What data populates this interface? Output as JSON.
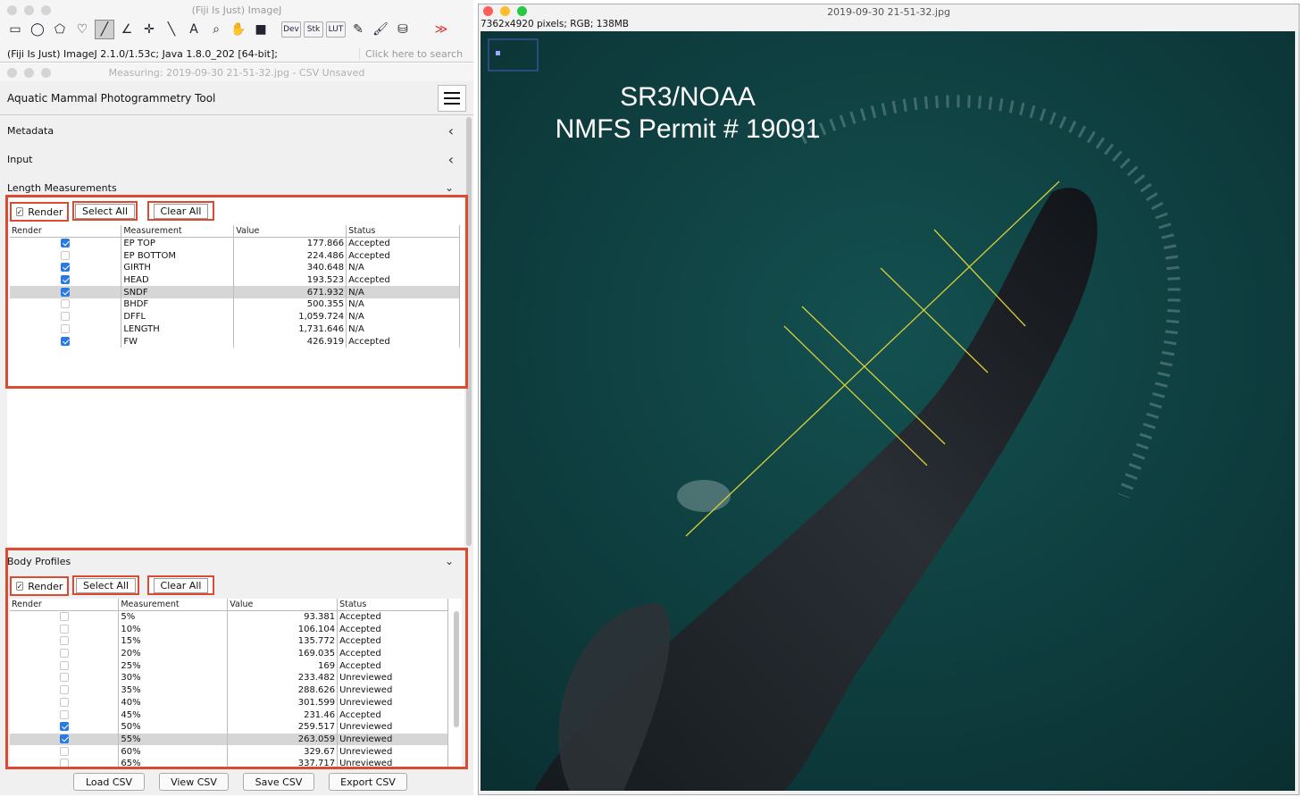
{
  "imagej": {
    "title": "(Fiji Is Just) ImageJ",
    "status": "(Fiji Is Just) ImageJ 2.1.0/1.53c; Java 1.8.0_202 [64-bit];",
    "search_placeholder": "Click here to search",
    "tools_small": [
      "Dev",
      "Stk",
      "LUT"
    ]
  },
  "plugin": {
    "title": "Measuring: 2019-09-30 21-51-32.jpg  - CSV Unsaved",
    "header": "Aquatic Mammal Photogrammetry Tool",
    "sections": {
      "metadata": "Metadata",
      "input": "Input",
      "length": "Length Measurements",
      "body": "Body Profiles"
    },
    "render_label": "Render",
    "select_all": "Select All",
    "clear_all": "Clear All",
    "columns": [
      "Render",
      "Measurement",
      "Value",
      "Status"
    ],
    "length_rows": [
      {
        "name": "EP TOP",
        "value": "177.866",
        "status": "Accepted",
        "checked": true,
        "selected": false
      },
      {
        "name": "EP BOTTOM",
        "value": "224.486",
        "status": "Accepted",
        "checked": false,
        "selected": false
      },
      {
        "name": "GIRTH",
        "value": "340.648",
        "status": "N/A",
        "checked": true,
        "selected": false
      },
      {
        "name": "HEAD",
        "value": "193.523",
        "status": "Accepted",
        "checked": true,
        "selected": false
      },
      {
        "name": "SNDF",
        "value": "671.932",
        "status": "N/A",
        "checked": true,
        "selected": true
      },
      {
        "name": "BHDF",
        "value": "500.355",
        "status": "N/A",
        "checked": false,
        "selected": false
      },
      {
        "name": "DFFL",
        "value": "1,059.724",
        "status": "N/A",
        "checked": false,
        "selected": false
      },
      {
        "name": "LENGTH",
        "value": "1,731.646",
        "status": "N/A",
        "checked": false,
        "selected": false
      },
      {
        "name": "FW",
        "value": "426.919",
        "status": "Accepted",
        "checked": true,
        "selected": false
      }
    ],
    "body_rows": [
      {
        "name": "5%",
        "value": "93.381",
        "status": "Accepted",
        "checked": false,
        "selected": false
      },
      {
        "name": "10%",
        "value": "106.104",
        "status": "Accepted",
        "checked": false,
        "selected": false
      },
      {
        "name": "15%",
        "value": "135.772",
        "status": "Accepted",
        "checked": false,
        "selected": false
      },
      {
        "name": "20%",
        "value": "169.035",
        "status": "Accepted",
        "checked": false,
        "selected": false
      },
      {
        "name": "25%",
        "value": "169",
        "status": "Accepted",
        "checked": false,
        "selected": false
      },
      {
        "name": "30%",
        "value": "233.482",
        "status": "Unreviewed",
        "checked": false,
        "selected": false
      },
      {
        "name": "35%",
        "value": "288.626",
        "status": "Unreviewed",
        "checked": false,
        "selected": false
      },
      {
        "name": "40%",
        "value": "301.599",
        "status": "Unreviewed",
        "checked": false,
        "selected": false
      },
      {
        "name": "45%",
        "value": "231.46",
        "status": "Accepted",
        "checked": false,
        "selected": false
      },
      {
        "name": "50%",
        "value": "259.517",
        "status": "Unreviewed",
        "checked": true,
        "selected": false
      },
      {
        "name": "55%",
        "value": "263.059",
        "status": "Unreviewed",
        "checked": true,
        "selected": true
      },
      {
        "name": "60%",
        "value": "329.67",
        "status": "Unreviewed",
        "checked": false,
        "selected": false
      },
      {
        "name": "65%",
        "value": "337.717",
        "status": "Unreviewed",
        "checked": false,
        "selected": false
      }
    ],
    "csv_buttons": [
      "Load CSV",
      "View CSV",
      "Save CSV",
      "Export CSV"
    ]
  },
  "image": {
    "title": "2019-09-30 21-51-32.jpg",
    "info": "7362x4920 pixels; RGB; 138MB",
    "watermark_line1": "SR3/NOAA",
    "watermark_line2": "NMFS Permit # 19091"
  },
  "colors": {
    "highlight": "#dd4a33",
    "checkbox": "#2a7ae2",
    "ocean": "#0e3a3a",
    "measure_line": "#d8d038"
  }
}
